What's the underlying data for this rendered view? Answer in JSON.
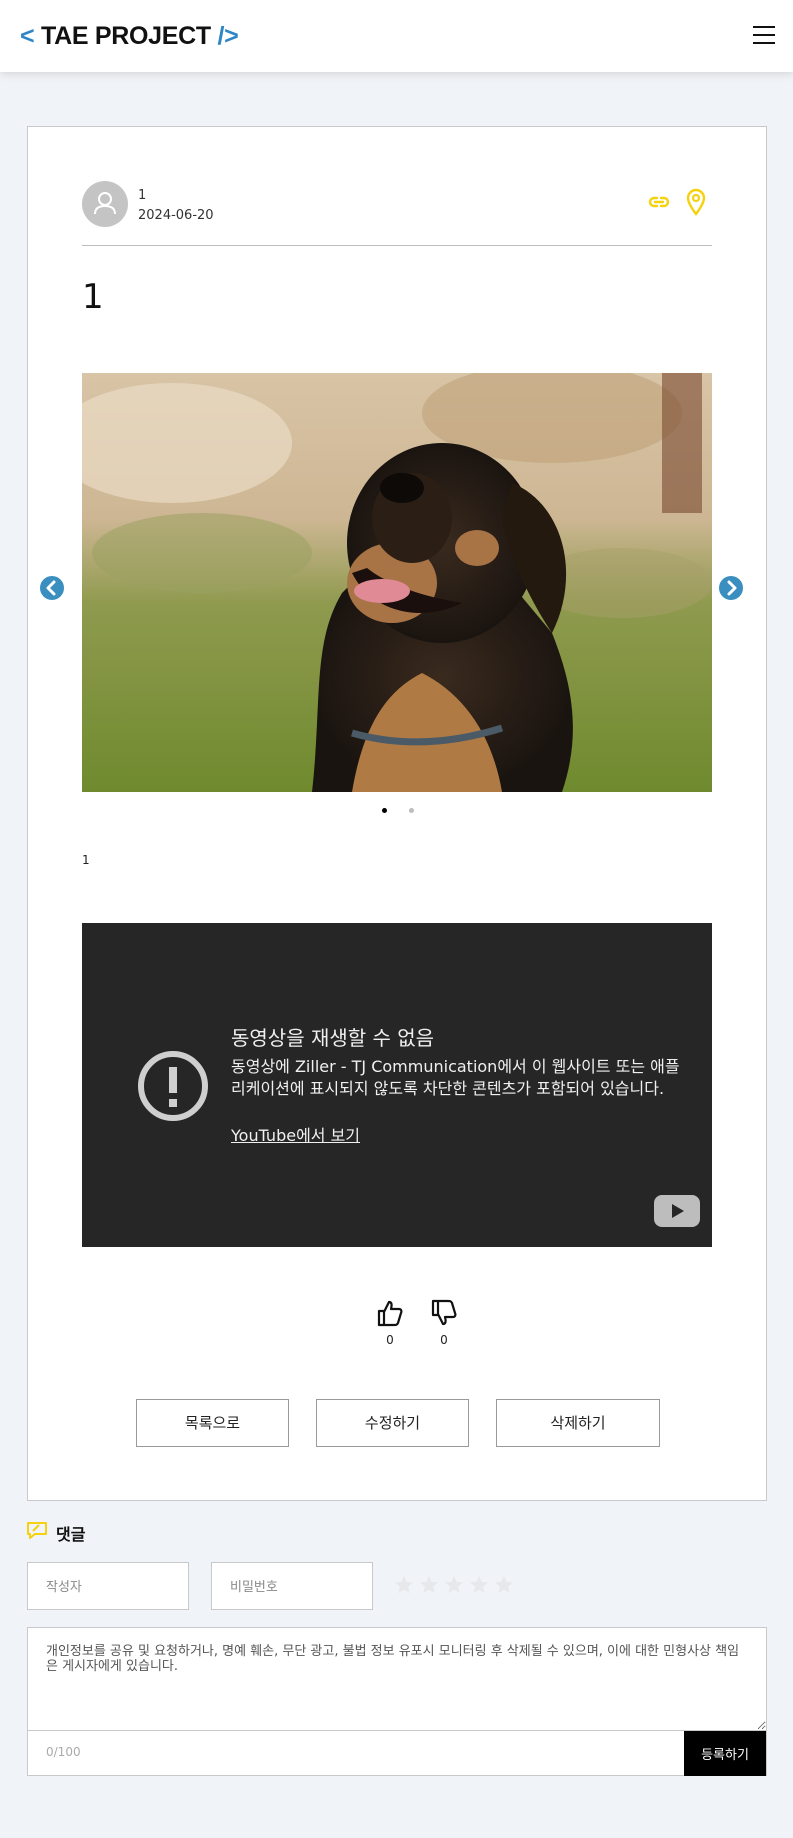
{
  "header": {
    "logo_open": "<",
    "logo_text": "TAE PROJECT",
    "logo_close": "/>",
    "menu_icon": "hamburger-icon"
  },
  "post": {
    "author": "1",
    "date": "2024-06-20",
    "title": "1",
    "body": "1",
    "action_icons": [
      "link-icon",
      "location-pin-icon"
    ],
    "accent_color": "#f5d20b",
    "slider": {
      "image": "dog-photo",
      "total_slides": 2,
      "active_slide": 1,
      "prev_icon": "chevron-left-circle-icon",
      "next_icon": "chevron-right-circle-icon",
      "arrow_color": "#3b8fc0"
    },
    "video": {
      "error_title": "동영상을 재생할 수 없음",
      "error_message": "동영상에 Ziller - TJ Communication에서 이 웹사이트 또는 애플리케이션에 표시되지 않도록 차단한 콘텐츠가 포함되어 있습니다.",
      "watch_link": "YouTube에서 보기"
    },
    "likes": "0",
    "dislikes": "0"
  },
  "buttons": {
    "list": "목록으로",
    "edit": "수정하기",
    "delete": "삭제하기"
  },
  "comments": {
    "label": "댓글",
    "author_placeholder": "작성자",
    "password_placeholder": "비밀번호",
    "rating_max": 5,
    "rating_value": 0,
    "textarea_placeholder": "개인정보를 공유 및 요청하거나, 명예 훼손, 무단 광고, 불법 정보 유포시 모니터링 후 삭제될 수 있으며, 이에 대한 민형사상 책임은 게시자에게 있습니다.",
    "char_counter": "0/100",
    "submit_label": "등록하기"
  }
}
